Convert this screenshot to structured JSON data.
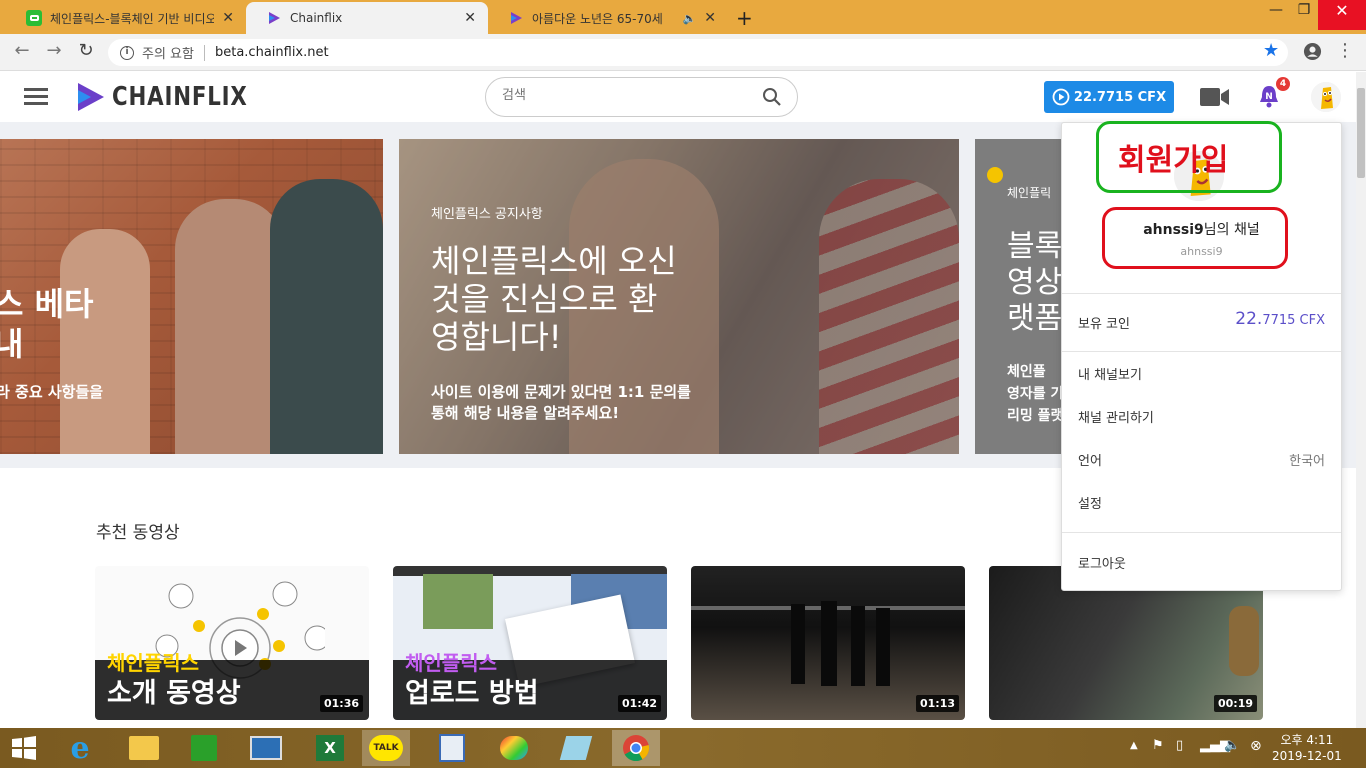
{
  "browser": {
    "tabs": [
      {
        "title": "체인플릭스-블록체인 기반 비디오",
        "favicon": "green-chat-icon"
      },
      {
        "title": "Chainflix",
        "favicon": "chainflix-logo-icon"
      },
      {
        "title": "아름다운 노년은 65-70세",
        "favicon": "chainflix-logo-icon"
      }
    ],
    "security_label": "주의 요함",
    "url": "beta.chainflix.net"
  },
  "header": {
    "logo_text": "CHAINFLIX",
    "search_placeholder": "검색",
    "coin_label": "22.7715 CFX",
    "notification_count": "4",
    "notification_letter": "N"
  },
  "banner": {
    "slide1": {
      "line1": "스 베타",
      "line2": "내",
      "sub": "라 중요 사항들을"
    },
    "slide2": {
      "tag": "체인플릭스 공지사항",
      "title_lines": [
        "체인플릭스에 오신",
        "것을 진심으로 환",
        "영합니다!"
      ],
      "desc_lines": [
        "사이트 이용에 문제가 있다면 1:1 문의를",
        "통해 해당 내용을 알려주세요!"
      ]
    },
    "slide3": {
      "tag": "체인플릭",
      "title_lines": [
        "블록",
        "영상",
        "랫폼"
      ],
      "desc_lines": [
        "체인플",
        "영자를 기",
        "리밍 플랫"
      ]
    }
  },
  "dropdown": {
    "annotation_signup": "회원가입",
    "channel_name": "ahnssi9",
    "channel_suffix": "님의 채널",
    "channel_id": "ahnssi9",
    "coin_label": "보유 코인",
    "coin_int": "22.",
    "coin_frac": "7715 CFX",
    "my_channel": "내 채널보기",
    "manage_channel": "채널 관리하기",
    "language_label": "언어",
    "language_value": "한국어",
    "settings": "설정",
    "logout": "로그아웃"
  },
  "section": {
    "title": "추천 동영상",
    "videos": [
      {
        "line1": "체인플릭스",
        "line2": "소개 동영상",
        "duration": "01:36"
      },
      {
        "line1": "체인플릭스",
        "line2": "업로드 방법",
        "duration": "01:42"
      },
      {
        "line1": "",
        "line2": "",
        "duration": "01:13"
      },
      {
        "line1": "",
        "line2": "",
        "duration": "00:19"
      }
    ]
  },
  "taskbar": {
    "time": "오후 4:11",
    "date": "2019-12-01",
    "kakao_label": "TALK"
  },
  "colors": {
    "accent_blue": "#1d8ae6",
    "coin_purple": "#5b4fc9",
    "highlight_yellow": "#ffd400",
    "highlight_purple": "#b044e8",
    "annotation_red": "#e0101c",
    "annotation_green": "#19b31f"
  }
}
